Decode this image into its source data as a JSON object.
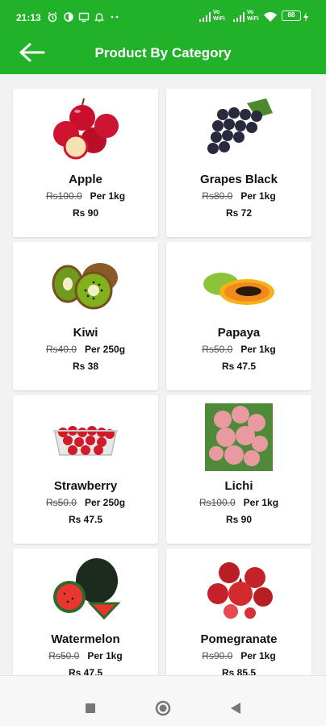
{
  "status": {
    "time": "21:13",
    "battery": "88",
    "network_labels": [
      "Vo WiFi",
      "Vo WiFi"
    ]
  },
  "header": {
    "title": "Product By Category",
    "back_icon": "arrow-left-icon"
  },
  "colors": {
    "primary": "#22b229",
    "card_bg": "#ffffff",
    "page_bg": "#f2f2f2"
  },
  "products": [
    {
      "name": "Apple",
      "mrp": "Rs100.0",
      "unit": "Per 1kg",
      "price": "Rs 90",
      "icon": "apple"
    },
    {
      "name": "Grapes Black",
      "mrp": "Rs80.0",
      "unit": "Per 1kg",
      "price": "Rs 72",
      "icon": "grapes"
    },
    {
      "name": "Kiwi",
      "mrp": "Rs40.0",
      "unit": "Per 250g",
      "price": "Rs 38",
      "icon": "kiwi"
    },
    {
      "name": "Papaya",
      "mrp": "Rs50.0",
      "unit": "Per 1kg",
      "price": "Rs 47.5",
      "icon": "papaya"
    },
    {
      "name": "Strawberry",
      "mrp": "Rs50.0",
      "unit": "Per 250g",
      "price": "Rs 47.5",
      "icon": "strawberry"
    },
    {
      "name": "Lichi",
      "mrp": "Rs100.0",
      "unit": "Per 1kg",
      "price": "Rs 90",
      "icon": "lichi"
    },
    {
      "name": "Watermelon",
      "mrp": "Rs50.0",
      "unit": "Per 1kg",
      "price": "Rs 47.5",
      "icon": "watermelon"
    },
    {
      "name": "Pomegranate",
      "mrp": "Rs90.0",
      "unit": "Per 1kg",
      "price": "Rs 85.5",
      "icon": "pomegranate"
    }
  ],
  "navbar": {
    "recents_icon": "square-icon",
    "home_icon": "circle-icon",
    "back_icon": "triangle-back-icon"
  }
}
